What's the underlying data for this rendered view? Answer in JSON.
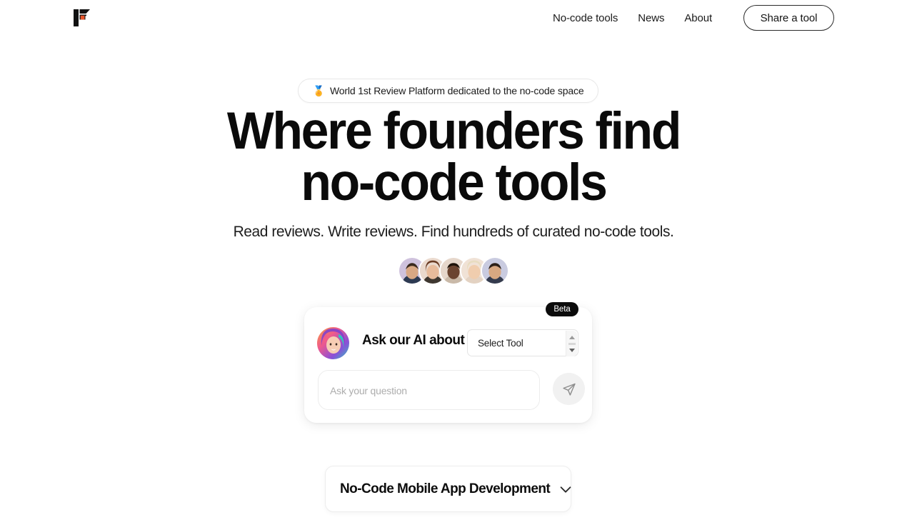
{
  "header": {
    "logo_name": "foundersbeta-logo",
    "logo_colors": {
      "dark": "#111111",
      "accent": "#E8552B"
    },
    "nav": [
      {
        "label": "No-code tools",
        "name": "nav-no-code-tools"
      },
      {
        "label": "News",
        "name": "nav-news"
      },
      {
        "label": "About",
        "name": "nav-about"
      }
    ],
    "share_button": "Share a tool"
  },
  "hero": {
    "badge": {
      "emoji": "🏅",
      "text": "World 1st Review Platform dedicated to the no-code space"
    },
    "headline_line1": "Where founders find",
    "headline_line2": "no-code tools",
    "subtitle": "Read reviews. Write reviews. Find hundreds of curated no-code tools.",
    "avatars": [
      {
        "name": "avatar-1",
        "bg": "#cfc2dd",
        "skin": "#d9a884",
        "hair": "#3a2a1e"
      },
      {
        "name": "avatar-2",
        "bg": "#ead9cd",
        "skin": "#e8bb9b",
        "hair": "#6a3a22"
      },
      {
        "name": "avatar-3",
        "bg": "#e6d7cb",
        "skin": "#6b4430",
        "hair": "#1d1209"
      },
      {
        "name": "avatar-4",
        "bg": "#f0e2d6",
        "skin": "#f0cdae",
        "hair": "#e8dcc0"
      },
      {
        "name": "avatar-5",
        "bg": "#c9cbe0",
        "skin": "#d8a881",
        "hair": "#2c2018"
      }
    ]
  },
  "ai_card": {
    "beta_label": "Beta",
    "title": "Ask our AI about",
    "select_value": "Select Tool",
    "input_placeholder": "Ask your question",
    "send_icon": "send-paper-plane-icon",
    "avatar_name": "ai-assistant-avatar"
  },
  "category_card": {
    "title": "No-Code Mobile App Development",
    "chevron_icon": "chevron-down-icon"
  }
}
